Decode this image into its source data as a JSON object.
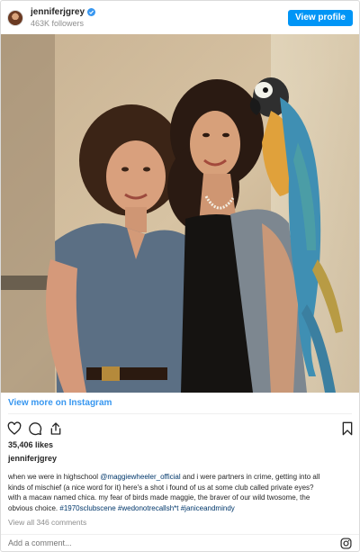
{
  "header": {
    "username": "jenniferjgrey",
    "followers": "463K followers",
    "view_profile_label": "View profile"
  },
  "post": {
    "view_more_label": "View more on Instagram",
    "likes": "35,406 likes",
    "owner": "jenniferjgrey",
    "caption_lines": [
      "when we were in highschool @maggiewheeler_official and i were partners in crime, getting into all",
      "kinds of mischief (a nice word for it) here's a shot i found of us at some club called private eyes?",
      "with a macaw named chica. my fear of birds made maggie, the braver of our wild twosome, the",
      "obvious choice. #1970sclubscene #wedonotrecallsh*t #janiceandmindy"
    ],
    "view_all_comments": "View all 346 comments",
    "comment_placeholder": "Add a comment..."
  },
  "icons": {
    "like": "heart-icon",
    "comment": "comment-icon",
    "share": "share-icon",
    "save": "bookmark-icon",
    "verified": "verified-badge-icon",
    "instagram": "instagram-logo-icon"
  },
  "colors": {
    "accent": "#0095f6",
    "link": "#3897f0",
    "muted": "#8e8e8e",
    "text": "#262626"
  }
}
